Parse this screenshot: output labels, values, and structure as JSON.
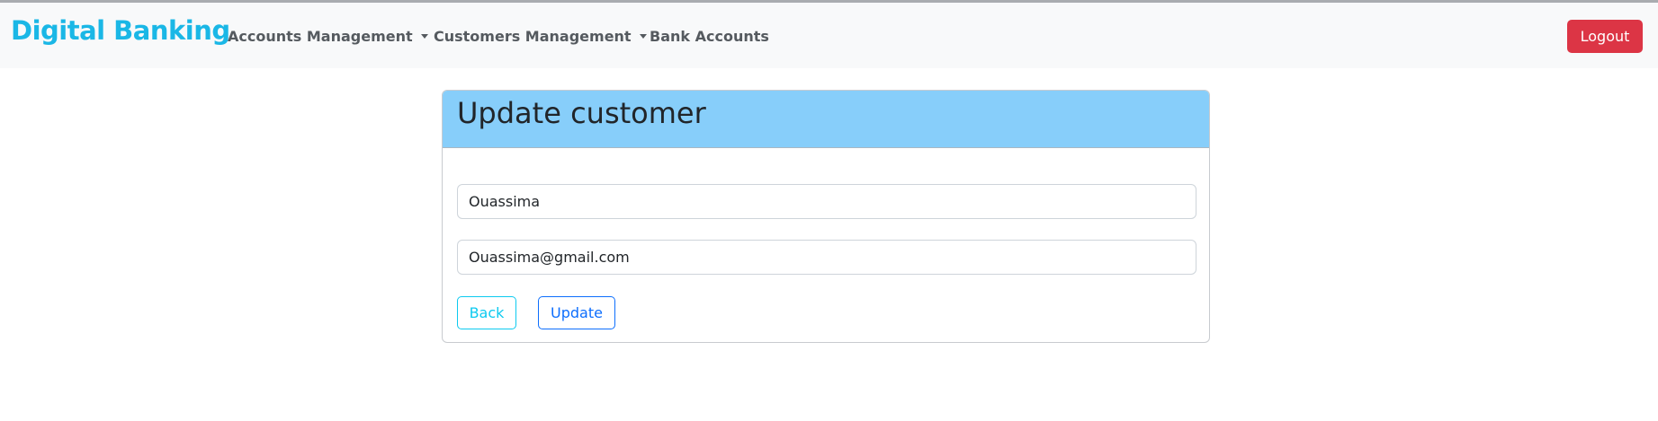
{
  "navbar": {
    "brand": "Digital Banking",
    "items": [
      {
        "label": "Accounts Management",
        "dropdown": true
      },
      {
        "label": "Customers Management",
        "dropdown": true
      },
      {
        "label": "Bank Accounts",
        "dropdown": false
      }
    ],
    "logout_label": "Logout"
  },
  "form": {
    "title": "Update customer",
    "name_value": "Ouassima",
    "email_value": "Ouassima@gmail.com",
    "back_label": "Back",
    "update_label": "Update"
  },
  "colors": {
    "brand": "#1ab7e6",
    "header_bg": "#87cefa",
    "logout_bg": "#dc3545",
    "back_outline": "#0dcaf0",
    "update_outline": "#0d6efd"
  }
}
